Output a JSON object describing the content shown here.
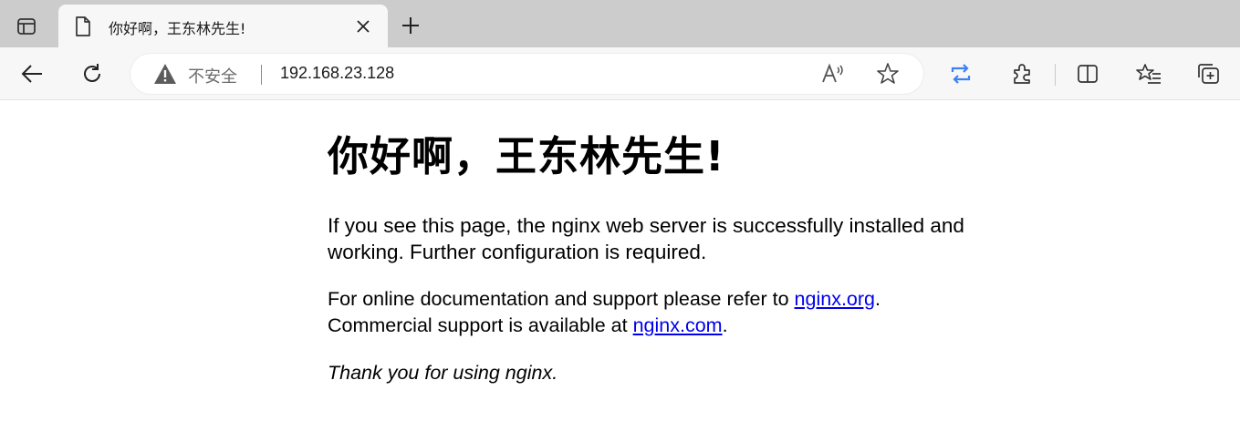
{
  "browser": {
    "tab": {
      "title": "你好啊，王东林先生!"
    },
    "address_bar": {
      "security_label": "不安全",
      "url": "192.168.23.128"
    }
  },
  "page": {
    "heading": "你好啊，王东林先生!",
    "paragraph1": "If you see this page, the nginx web server is successfully installed and working. Further configuration is required.",
    "paragraph2_prefix": "For online documentation and support please refer to ",
    "link1_text": "nginx.org",
    "paragraph2_mid": ".",
    "paragraph2_line2": "Commercial support is available at ",
    "link2_text": "nginx.com",
    "paragraph2_end": ".",
    "thanks": "Thank you for using nginx."
  },
  "icons": {
    "accent_color": "#3b82f6",
    "warning_color": "#5c5c5c"
  }
}
